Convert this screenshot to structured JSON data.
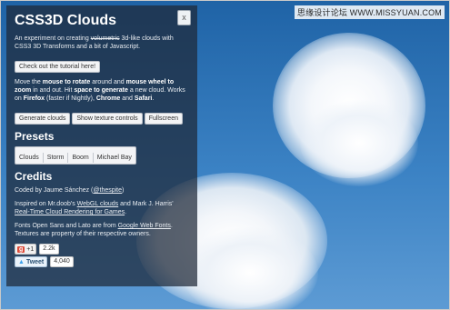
{
  "watermark": "思缘设计论坛  WWW.MISSYUAN.COM",
  "panel": {
    "title": "CSS3D Clouds",
    "close_label": "x",
    "intro_pre": "An experiment on creating ",
    "intro_strike": "volumetric",
    "intro_post": " 3d-like clouds with CSS3 3D Transforms and a bit of Javascript.",
    "tutorial_button": "Check out the tutorial here!",
    "instructions": {
      "t1": "Move the ",
      "b1": "mouse to rotate",
      "t2": " around and ",
      "b2": "mouse wheel to zoom",
      "t3": " in and out. Hit ",
      "b3": "space to generate",
      "t4": " a new cloud. Works on ",
      "b4": "Firefox",
      "t5": " (faster if Nightly), ",
      "b5": "Chrome",
      "t6": " and ",
      "b6": "Safari",
      "t7": "."
    },
    "buttons": {
      "generate": "Generate clouds",
      "texture": "Show texture controls",
      "fullscreen": "Fullscreen"
    },
    "presets_heading": "Presets",
    "presets": [
      "Clouds",
      "Storm",
      "Boom",
      "Michael Bay"
    ],
    "credits_heading": "Credits",
    "credits": {
      "coded_pre": "Coded by Jaume Sánchez (",
      "coded_link": "@thespite",
      "coded_post": ")",
      "inspired_pre": "Inspired on Mr.doob's ",
      "inspired_link1": "WebGL clouds",
      "inspired_mid": " and Mark J. Harris' ",
      "inspired_link2": "Real-Time Cloud Rendering for Games",
      "inspired_post": ".",
      "fonts_pre": "Fonts Open Sans and Lato are from ",
      "fonts_link": "Google Web Fonts",
      "fonts_post": ". Textures are property of their respective owners."
    },
    "social": {
      "gplus_label": "+1",
      "gplus_g": "g",
      "gplus_count": "2.2k",
      "tweet_label": "Tweet",
      "tweet_count": "4,040"
    }
  }
}
